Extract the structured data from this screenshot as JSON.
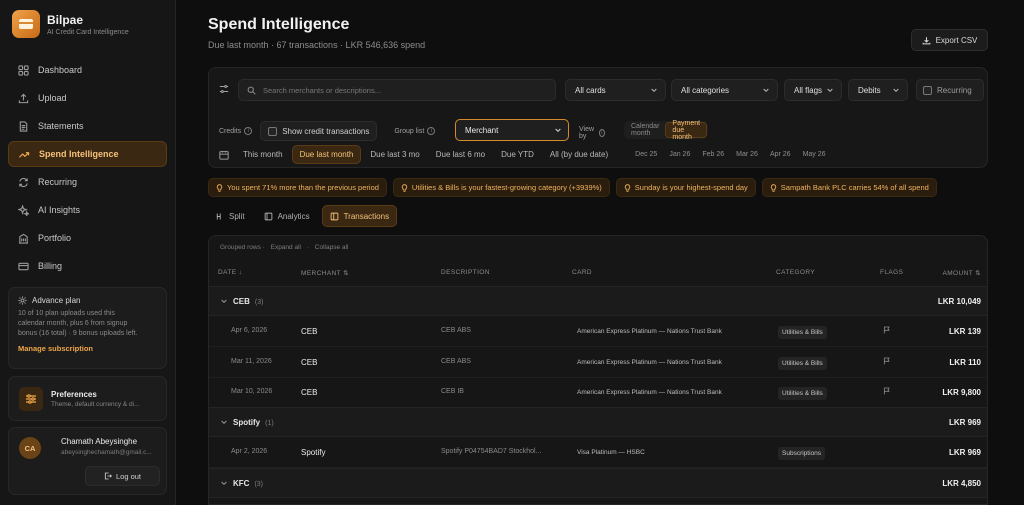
{
  "brand": {
    "name": "Bilpae",
    "tagline": "AI Credit Card Intelligence"
  },
  "nav": [
    {
      "label": "Dashboard",
      "icon": "dashboard-icon"
    },
    {
      "label": "Upload",
      "icon": "upload-icon"
    },
    {
      "label": "Statements",
      "icon": "document-icon"
    },
    {
      "label": "Spend Intelligence",
      "icon": "trend-icon",
      "active": true
    },
    {
      "label": "Recurring",
      "icon": "repeat-icon"
    },
    {
      "label": "AI Insights",
      "icon": "sparkle-icon"
    },
    {
      "label": "Portfolio",
      "icon": "building-icon"
    },
    {
      "label": "Billing",
      "icon": "credit-card-icon"
    }
  ],
  "plan": {
    "title": "Advance plan",
    "desc_1": "10 of 10 plan uploads used this",
    "desc_2": "calendar month, plus 6 from signup",
    "desc_3": "bonus (16 total) · 9 bonus uploads left.",
    "link": "Manage subscription"
  },
  "prefs": {
    "title": "Preferences",
    "sub": "Theme, default currency & di..."
  },
  "user": {
    "initials": "CA",
    "name": "Chamath Abeysinghe",
    "email": "abeysinghechamath@gmail.c...",
    "logout": "Log out"
  },
  "header": {
    "title": "Spend Intelligence",
    "subtitle": "Due last month · 67 transactions · LKR 546,636 spend",
    "export": "Export CSV"
  },
  "filters": {
    "search_placeholder": "Search merchants or descriptions...",
    "cards": "All cards",
    "categories": "All categories",
    "flags": "All flags",
    "direction": "Debits",
    "recurring": "Recurring",
    "credits_label": "Credits",
    "show_credit": "Show credit transactions",
    "group_label": "Group list",
    "group_value": "Merchant",
    "viewby_label": "View by",
    "viewby_options": [
      "Calendar month",
      "Payment due month"
    ],
    "periods": [
      "This month",
      "Due last month",
      "Due last 3 mo",
      "Due last 6 mo",
      "Due YTD",
      "All (by due date)"
    ],
    "months": [
      "Dec 25",
      "Jan 26",
      "Feb 26",
      "Mar 26",
      "Apr 26",
      "May 26"
    ]
  },
  "insights": [
    "You spent 71% more than the previous period",
    "Utilities & Bills is your fastest-growing category (+3939%)",
    "Sunday is your highest-spend day",
    "Sampath Bank PLC carries 54% of all spend"
  ],
  "tabs": [
    "Split",
    "Analytics",
    "Transactions"
  ],
  "table": {
    "grouped_label": "Grouped rows ·",
    "expand_all": "Expand all",
    "sep": "·",
    "collapse_all": "Collapse all",
    "headers": {
      "date": "DATE ↓",
      "merchant": "MERCHANT ⇅",
      "description": "DESCRIPTION",
      "card": "CARD",
      "category": "CATEGORY",
      "flags": "FLAGS",
      "amount": "AMOUNT ⇅"
    },
    "groups": [
      {
        "name": "CEB",
        "count": "(3)",
        "total": "LKR 10,049"
      },
      {
        "name": "Spotify",
        "count": "(1)",
        "total": "LKR 969"
      },
      {
        "name": "KFC",
        "count": "(3)",
        "total": "LKR 4,850"
      }
    ],
    "rows": [
      {
        "date": "Apr 6, 2026",
        "merchant": "CEB",
        "description": "CEB ABS",
        "card": "American Express Platinum — Nations Trust Bank",
        "category": "Utilities & Bills",
        "amount": "LKR 139"
      },
      {
        "date": "Mar 11, 2026",
        "merchant": "CEB",
        "description": "CEB ABS",
        "card": "American Express Platinum — Nations Trust Bank",
        "category": "Utilities & Bills",
        "amount": "LKR 110"
      },
      {
        "date": "Mar 10, 2026",
        "merchant": "CEB",
        "description": "CEB IB",
        "card": "American Express Platinum — Nations Trust Bank",
        "category": "Utilities & Bills",
        "amount": "LKR 9,800"
      },
      {
        "date": "Apr 2, 2026",
        "merchant": "Spotify",
        "description": "Spotify P04754BAD7 Stockhol...",
        "card": "Visa Platinum — HSBC",
        "category": "Subscriptions",
        "amount": "LKR 969"
      }
    ]
  },
  "colors": {
    "accent": "#f0a548",
    "accent_bg": "#3a2813",
    "background": "#0e0e0e"
  }
}
